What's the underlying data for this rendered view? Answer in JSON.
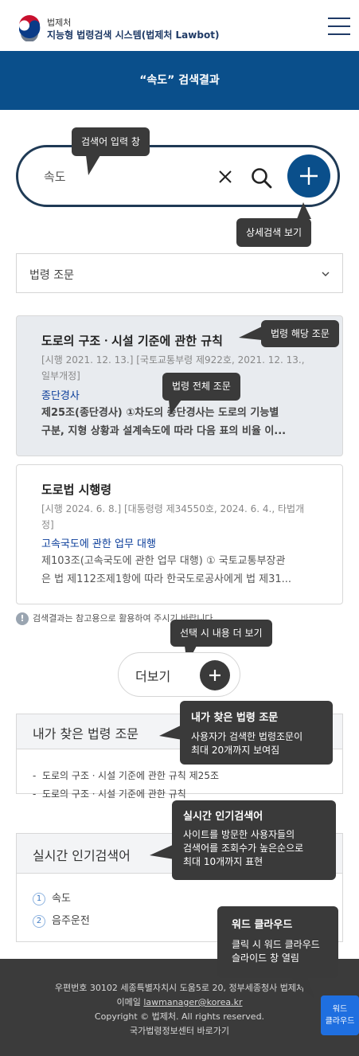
{
  "header": {
    "org": "법제처",
    "title": "지능형 법령검색 시스템(법제처 Lawbot)"
  },
  "banner": {
    "text": "“속도” 검색결과"
  },
  "search": {
    "value": "속도"
  },
  "tooltips": {
    "search_input": "검색어 입력 창",
    "detail_search": "상세검색 보기",
    "law_article": "법령 해당 조문",
    "law_full": "법령 전체 조문",
    "more": "선택 시 내용 더 보기",
    "my_laws_title": "내가 찾은 법령 조문",
    "my_laws_desc1": "사용자가 검색한 법령조문이",
    "my_laws_desc2": "최대 20개까지 보여짐",
    "popular_title": "실시간 인기검색어",
    "popular_desc1": "사이트를 방문한 사용자들의",
    "popular_desc2": "검색어를 조회수가 높은순으로",
    "popular_desc3": "최대 10개까지 표현",
    "wordcloud_title": "워드 클라우드",
    "wordcloud_desc1": "클릭 시 워드 클라우드",
    "wordcloud_desc2": "슬라이드 창 열림"
  },
  "filter": {
    "selected": "법령 조문"
  },
  "results": [
    {
      "title": "도로의 구조ㆍ시설 기준에 관한 규칙",
      "meta_line1": "[시행 2021. 12. 13.] [국토교통부령 제922호, 2021. 12. 13.,",
      "meta_line2": "일부개정]",
      "article_title": "종단경사",
      "body_line1": "제25조(종단경사) ①차도의 종단경사는 도로의 기능별",
      "body_line2": "구분, 지형 상황과 설계속도에 따라 다음 표의 비율 이..."
    },
    {
      "title": "도로법 시행령",
      "meta_line1": "[시행 2024. 6. 8.] [대통령령 제34550호, 2024. 6. 4., 타법개",
      "meta_line2": "정]",
      "article_title": "고속국도에 관한 업무 대행",
      "body_line1": "제103조(고속국도에 관한 업무 대행) ① 국토교통부장관",
      "body_line2": "은 법 제112조제1항에 따라 한국도로공사에게 법 제31..."
    }
  ],
  "notice": "검색결과는 참고용으로 활용하여 주시기 바랍니다.",
  "more_label": "더보기",
  "my_laws": {
    "title": "내가 찾은 법령 조문",
    "items": [
      "도로의 구조ㆍ시설 기준에 관한 규칙 제25조",
      "도로의 구조ㆍ시설 기준에 관한 규칙"
    ]
  },
  "popular": {
    "title": "실시간 인기검색어",
    "items": [
      {
        "rank": "1",
        "term": "속도"
      },
      {
        "rank": "2",
        "term": "음주운전"
      }
    ]
  },
  "footer": {
    "address": "우편번호 30102 세종특별자치시 도움5로 20, 정부세종청사 법제처",
    "email_label": "이메일",
    "email": "lawmanager@korea.kr",
    "copyright": "Copyright © 법제처. All rights reserved.",
    "center": "국가법령정보센터 바로가기"
  },
  "wordcloud_btn": {
    "line1": "워드",
    "line2": "클라우드"
  },
  "colors": {
    "brand": "#0a4f8b",
    "tooltip": "#3a3a3a",
    "wordcloud": "#1f6fe0"
  }
}
